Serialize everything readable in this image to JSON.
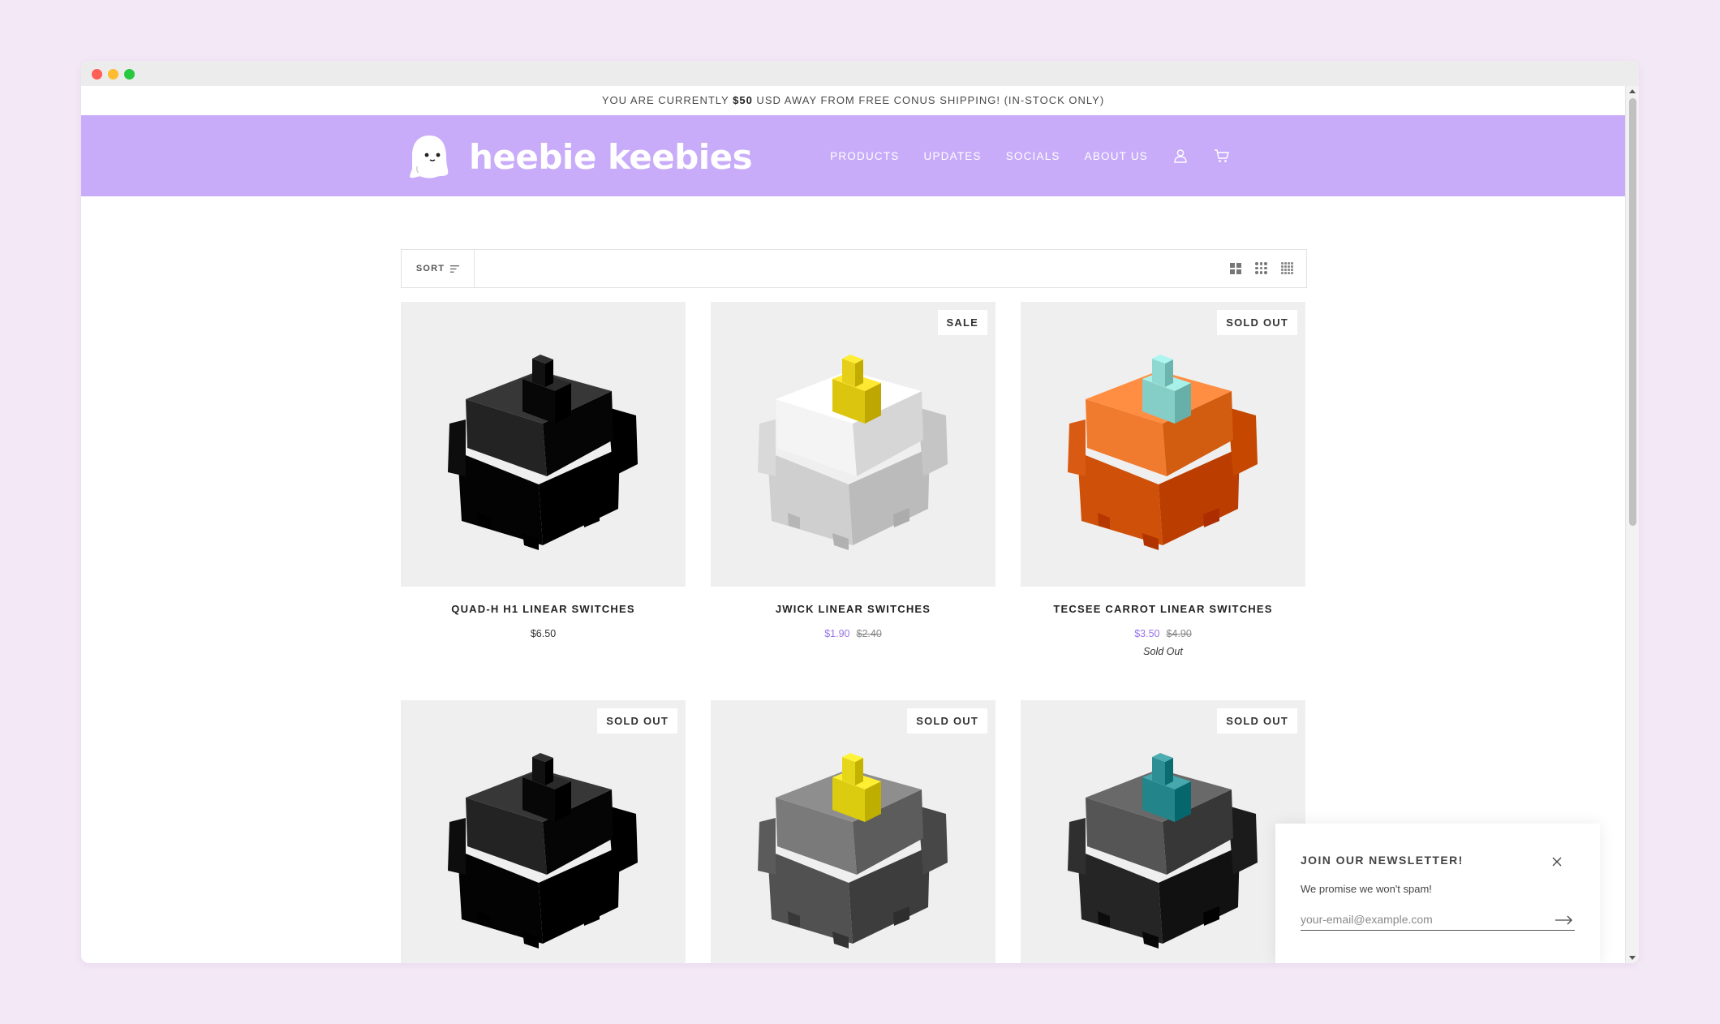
{
  "announcement": {
    "prefix": "YOU ARE CURRENTLY ",
    "amount": "$50",
    "suffix": " USD AWAY FROM FREE CONUS SHIPPING! (IN-STOCK ONLY)"
  },
  "brand": {
    "name": "heebie keebies",
    "header_color": "#c8acfa",
    "sale_color": "#9a72e8"
  },
  "nav": {
    "items": [
      "PRODUCTS",
      "UPDATES",
      "SOCIALS",
      "ABOUT US"
    ],
    "account_icon": "user-icon",
    "cart_icon": "cart-icon"
  },
  "toolbar": {
    "sort_label": "SORT",
    "sort_icon": "sort-icon",
    "view_icons": [
      "grid-2-icon",
      "grid-3-icon",
      "grid-4-icon"
    ]
  },
  "products": [
    {
      "title": "QUAD-H H1 LINEAR SWITCHES",
      "price": "$6.50",
      "sale_price": "",
      "compare_price": "",
      "badge": "",
      "status": "",
      "switch_colors": {
        "housing": "#1c1c1c",
        "stem": "#111111",
        "top": "#232323"
      }
    },
    {
      "title": "JWICK LINEAR SWITCHES",
      "price": "",
      "sale_price": "$1.90",
      "compare_price": "$2.40",
      "badge": "SALE",
      "status": "",
      "switch_colors": {
        "housing": "#e8e8e8",
        "stem": "#e6cf18",
        "top": "#f4f4f4"
      }
    },
    {
      "title": "TECSEE CARROT LINEAR SWITCHES",
      "price": "",
      "sale_price": "$3.50",
      "compare_price": "$4.90",
      "badge": "SOLD OUT",
      "status": "Sold Out",
      "switch_colors": {
        "housing": "#e86a22",
        "stem": "#8fd8d2",
        "top": "#f07a2e"
      }
    },
    {
      "title": "",
      "price": "",
      "sale_price": "",
      "compare_price": "",
      "badge": "SOLD OUT",
      "status": "",
      "switch_colors": {
        "housing": "#1c1c1c",
        "stem": "#111111",
        "top": "#232323"
      }
    },
    {
      "title": "",
      "price": "",
      "sale_price": "",
      "compare_price": "",
      "badge": "SOLD OUT",
      "status": "",
      "switch_colors": {
        "housing": "#6a6a6a",
        "stem": "#e6d61a",
        "top": "#7a7a7a"
      }
    },
    {
      "title": "",
      "price": "",
      "sale_price": "",
      "compare_price": "",
      "badge": "SOLD OUT",
      "status": "",
      "switch_colors": {
        "housing": "#3e3e3e",
        "stem": "#2d8e93",
        "top": "#555555"
      }
    }
  ],
  "newsletter": {
    "title": "JOIN OUR NEWSLETTER!",
    "text": "We promise we won't spam!",
    "placeholder": "your-email@example.com",
    "close_icon": "close-icon",
    "submit_icon": "arrow-right-icon"
  }
}
